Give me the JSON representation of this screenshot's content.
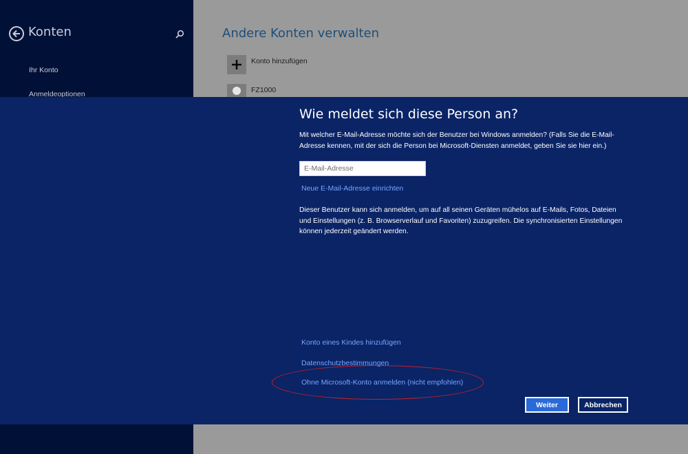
{
  "sidebar": {
    "title": "Konten",
    "items": [
      {
        "label": "Ihr Konto"
      },
      {
        "label": "Anmeldeoptionen"
      }
    ]
  },
  "main": {
    "title": "Andere Konten verwalten",
    "add_account_label": "Konto hinzufügen",
    "user_name": "FZ1000"
  },
  "dialog": {
    "title": "Wie meldet sich diese Person an?",
    "description": "Mit welcher E-Mail-Adresse möchte sich der Benutzer bei Windows anmelden? (Falls Sie die E-Mail-Adresse kennen, mit der sich die Person bei Microsoft-Diensten anmeldet, geben Sie sie hier ein.)",
    "email": {
      "placeholder": "E-Mail-Adresse",
      "value": ""
    },
    "new_email_link": "Neue E-Mail-Adresse einrichten",
    "info": "Dieser Benutzer kann sich anmelden, um auf all seinen Geräten mühelos auf E-Mails, Fotos, Dateien und Einstellungen (z. B. Browserverlauf und Favoriten) zuzugreifen. Die synchronisierten Einstellungen können jederzeit geändert werden.",
    "child_account_link": "Konto eines Kindes hinzufügen",
    "privacy_link": "Datenschutzbestimmungen",
    "local_account_link": "Ohne Microsoft-Konto anmelden (nicht empfohlen)",
    "next_button": "Weiter",
    "cancel_button": "Abbrechen"
  },
  "colors": {
    "dialog_bg": "#0a2466",
    "sidebar_bg": "#011037",
    "link": "#79a6ff",
    "primary_button": "#2a6ad8",
    "annotation": "#c4202a"
  }
}
